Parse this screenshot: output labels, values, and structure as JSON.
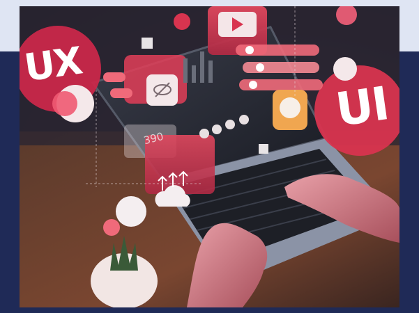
{
  "overlays": {
    "ux_label": "UX",
    "ui_label": "UI",
    "price_label": "390"
  },
  "colors": {
    "accent_red": "#d8344f",
    "accent_pink": "#f06a7a",
    "frame_navy": "#1f2a57",
    "frame_light": "#dfe5f3",
    "orange_button": "#f0a650"
  }
}
